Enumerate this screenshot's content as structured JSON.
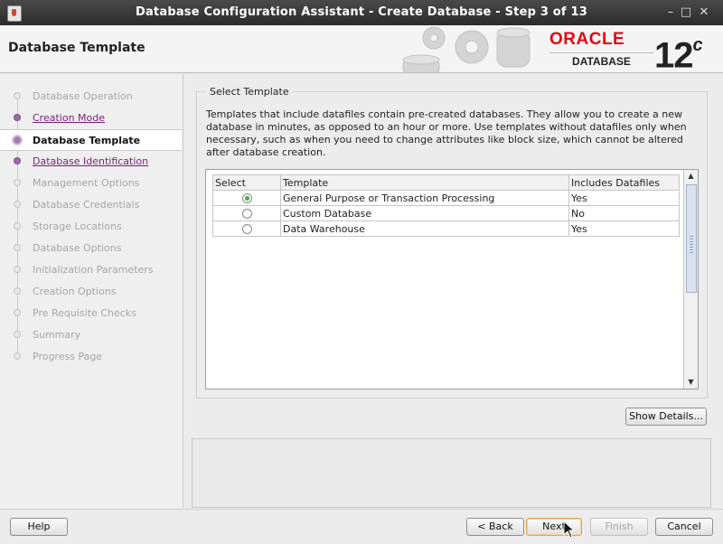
{
  "window": {
    "title": "Database Configuration Assistant - Create Database - Step 3 of 13",
    "controls": [
      "–",
      "□",
      "✕"
    ]
  },
  "header": {
    "page_title": "Database Template",
    "logo_brand": "ORACLE",
    "logo_product": "DATABASE",
    "logo_version": "12",
    "logo_version_suffix": "c"
  },
  "steps": [
    {
      "label": "Database Operation",
      "state": "done"
    },
    {
      "label": "Creation Mode",
      "state": "link"
    },
    {
      "label": "Database Template",
      "state": "current"
    },
    {
      "label": "Database Identification",
      "state": "link"
    },
    {
      "label": "Management Options",
      "state": "pending"
    },
    {
      "label": "Database Credentials",
      "state": "pending"
    },
    {
      "label": "Storage Locations",
      "state": "pending"
    },
    {
      "label": "Database Options",
      "state": "pending"
    },
    {
      "label": "Initialization Parameters",
      "state": "pending"
    },
    {
      "label": "Creation Options",
      "state": "pending"
    },
    {
      "label": "Pre Requisite Checks",
      "state": "pending"
    },
    {
      "label": "Summary",
      "state": "pending"
    },
    {
      "label": "Progress Page",
      "state": "pending"
    }
  ],
  "select_template": {
    "legend": "Select Template",
    "description": "Templates that include datafiles contain pre-created databases. They allow you to create a new database in minutes, as opposed to an hour or more. Use templates without datafiles only when necessary, such as when you need to change attributes like block size, which cannot be altered after database creation.",
    "columns": [
      "Select",
      "Template",
      "Includes Datafiles"
    ],
    "rows": [
      {
        "template": "General Purpose or Transaction Processing",
        "datafiles": "Yes",
        "selected": true
      },
      {
        "template": "Custom Database",
        "datafiles": "No",
        "selected": false
      },
      {
        "template": "Data Warehouse",
        "datafiles": "Yes",
        "selected": false
      }
    ]
  },
  "buttons": {
    "show_details": "Show Details...",
    "help": "Help",
    "back": "< Back",
    "next": "Next",
    "finish": "Finish",
    "cancel": "Cancel"
  },
  "colors": {
    "oracle_red": "#e30613",
    "link_purple": "#7a1e7a",
    "radio_selected": "#49a841"
  }
}
